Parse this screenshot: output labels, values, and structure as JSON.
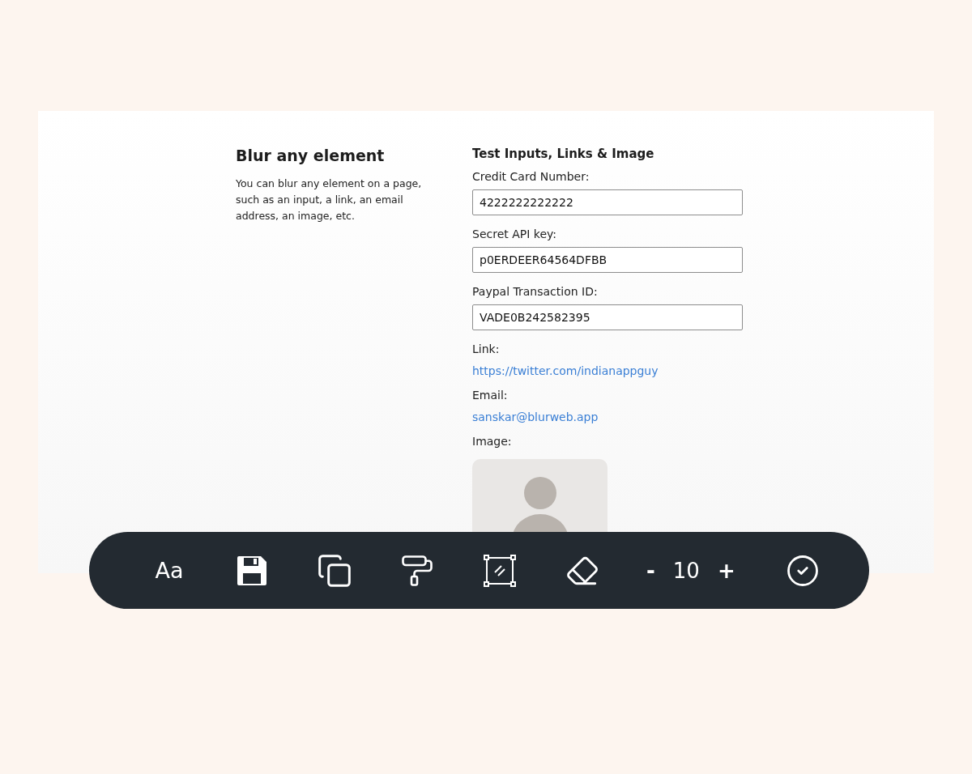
{
  "intro": {
    "title": "Blur any element",
    "description": "You can blur any element on a page, such as an input, a link, an email address, an image, etc."
  },
  "test_section": {
    "title": "Test Inputs, Links & Image",
    "fields": [
      {
        "label": "Credit Card Number:",
        "value": "4222222222222"
      },
      {
        "label": "Secret API key:",
        "value": "p0ERDEER64564DFBB"
      },
      {
        "label": "Paypal Transaction ID:",
        "value": "VADE0B242582395"
      }
    ],
    "links": [
      {
        "label": "Link:",
        "text": "https://twitter.com/indianappguy"
      },
      {
        "label": "Email:",
        "text": "sanskar@blurweb.app"
      }
    ],
    "image_label": "Image:"
  },
  "toolbar": {
    "items": [
      {
        "kind": "text",
        "text": "Aa"
      },
      {
        "kind": "save"
      },
      {
        "kind": "copy"
      },
      {
        "kind": "roller"
      },
      {
        "kind": "select"
      },
      {
        "kind": "eraser"
      }
    ],
    "size": {
      "minus": "-",
      "value": "10",
      "plus": "+"
    },
    "confirm": {
      "kind": "check"
    }
  }
}
